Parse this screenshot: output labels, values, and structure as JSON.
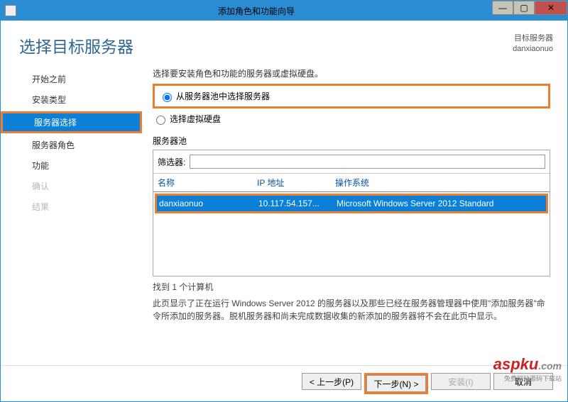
{
  "titlebar": {
    "title": "添加角色和功能向导"
  },
  "header": {
    "page_title": "选择目标服务器",
    "dest_label": "目标服务器",
    "dest_value": "danxiaonuo"
  },
  "sidebar": {
    "items": [
      {
        "label": "开始之前",
        "state": "normal"
      },
      {
        "label": "安装类型",
        "state": "normal"
      },
      {
        "label": "服务器选择",
        "state": "current"
      },
      {
        "label": "服务器角色",
        "state": "normal"
      },
      {
        "label": "功能",
        "state": "normal"
      },
      {
        "label": "确认",
        "state": "disabled"
      },
      {
        "label": "结果",
        "state": "disabled"
      }
    ]
  },
  "content": {
    "prompt": "选择要安装角色和功能的服务器或虚拟硬盘。",
    "radio_pool": "从服务器池中选择服务器",
    "radio_vhd": "选择虚拟硬盘",
    "pool_label": "服务器池",
    "filter_label": "筛选器:",
    "filter_value": "",
    "columns": {
      "name": "名称",
      "ip": "IP 地址",
      "os": "操作系统"
    },
    "rows": [
      {
        "name": "danxiaonuo",
        "ip": "10.117.54.157...",
        "os": "Microsoft Windows Server 2012 Standard"
      }
    ],
    "found": "找到 1 个计算机",
    "description": "此页显示了正在运行 Windows Server 2012 的服务器以及那些已经在服务器管理器中使用\"添加服务器\"命令所添加的服务器。脱机服务器和尚未完成数据收集的新添加的服务器将不会在此页中显示。"
  },
  "footer": {
    "prev": "< 上一步(P)",
    "next": "下一步(N) >",
    "install": "安装(I)",
    "cancel": "取消"
  },
  "watermark": {
    "brand": "aspku",
    "suffix": ".com",
    "subtitle": "免费网站源码下载站"
  }
}
